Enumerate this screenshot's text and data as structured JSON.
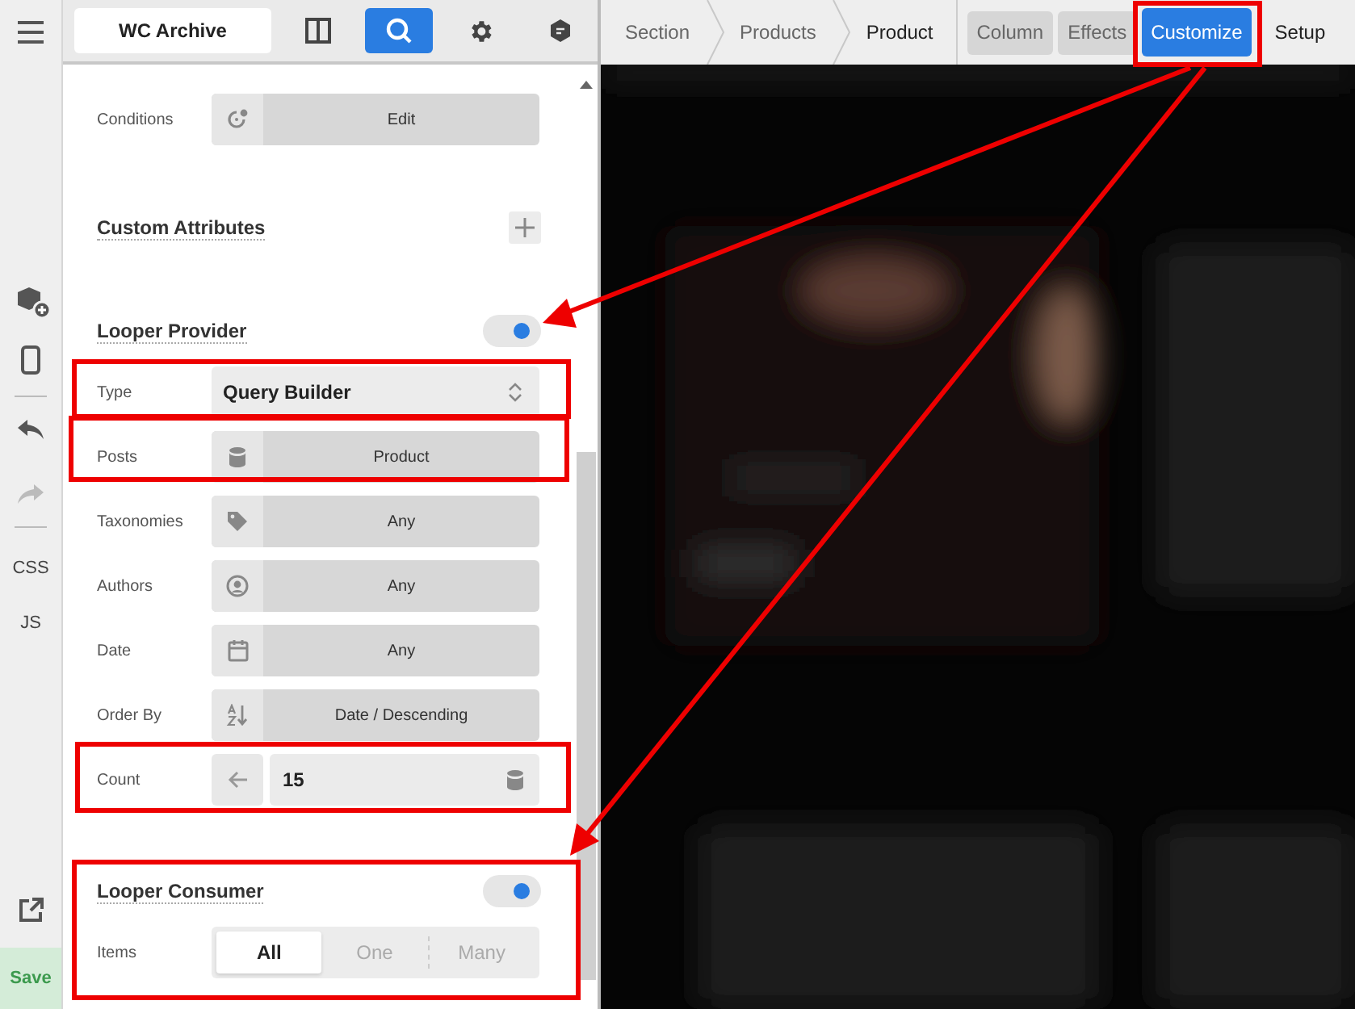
{
  "rail": {
    "css_label": "CSS",
    "js_label": "JS",
    "save_label": "Save",
    "redo_disabled": true
  },
  "panel_header": {
    "title": "WC Archive",
    "tabs": [
      {
        "kind": "columns",
        "selected": false
      },
      {
        "kind": "search",
        "selected": true
      },
      {
        "kind": "settings",
        "selected": false
      },
      {
        "kind": "badge",
        "selected": false
      }
    ]
  },
  "panel_rows": [
    {
      "kind": "field",
      "label": "Conditions",
      "value": "Edit"
    },
    {
      "kind": "add-heading",
      "label": "Custom Attributes"
    },
    {
      "kind": "toggle-heading",
      "label": "Looper Provider",
      "on": true
    },
    {
      "kind": "select",
      "label": "Type",
      "value": "Query Builder"
    },
    {
      "kind": "field",
      "label": "Posts",
      "value": "Product"
    },
    {
      "kind": "field",
      "label": "Taxonomies",
      "value": "Any"
    },
    {
      "kind": "field",
      "label": "Authors",
      "value": "Any"
    },
    {
      "kind": "field",
      "label": "Date",
      "value": "Any"
    },
    {
      "kind": "field",
      "label": "Order By",
      "value": "Date / Descending"
    },
    {
      "kind": "count",
      "label": "Count",
      "value": "15"
    },
    {
      "kind": "toggle-heading",
      "label": "Looper Consumer",
      "on": true
    },
    {
      "kind": "segmented",
      "label": "Items",
      "options": [
        {
          "label": "All",
          "selected": true
        },
        {
          "label": "One",
          "selected": false
        },
        {
          "label": "Many",
          "selected": false
        }
      ]
    }
  ],
  "breadcrumbs": [
    {
      "label": "Section",
      "current": false
    },
    {
      "label": "Products",
      "current": false
    },
    {
      "label": "Product",
      "current": true
    }
  ],
  "top_tabs": [
    {
      "label": "Column",
      "boxed": true,
      "selected": false
    },
    {
      "label": "Effects",
      "boxed": true,
      "selected": false
    },
    {
      "label": "Customize",
      "boxed": true,
      "selected": true
    },
    {
      "label": "Setup",
      "boxed": false,
      "selected": false
    }
  ]
}
